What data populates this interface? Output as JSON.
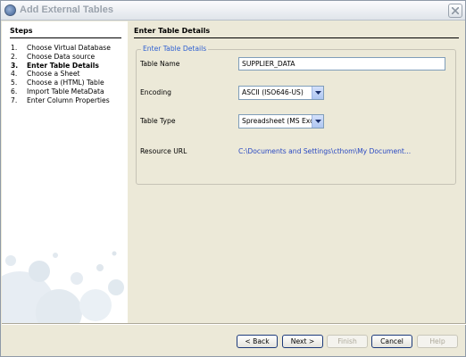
{
  "window": {
    "title": "Add External Tables"
  },
  "steps": {
    "header": "Steps",
    "items": [
      {
        "num": "1.",
        "label": "Choose Virtual Database"
      },
      {
        "num": "2.",
        "label": "Choose Data source"
      },
      {
        "num": "3.",
        "label": "Enter Table Details"
      },
      {
        "num": "4.",
        "label": "Choose a Sheet"
      },
      {
        "num": "5.",
        "label": "Choose a (HTML) Table"
      },
      {
        "num": "6.",
        "label": "Import Table MetaData"
      },
      {
        "num": "7.",
        "label": "Enter Column Properties"
      }
    ],
    "current": "Enter Table Details"
  },
  "content": {
    "header": "Enter Table Details",
    "group_title": "Enter Table Details",
    "table_name_label": "Table Name",
    "table_name_value": "SUPPLIER_DATA",
    "encoding_label": "Encoding",
    "encoding_value": "ASCII (ISO646-US)",
    "table_type_label": "Table Type",
    "table_type_value": "Spreadsheet (MS Excel)",
    "resource_url_label": "Resource URL",
    "resource_url_value": "C:\\Documents and Settings\\cthom\\My Document..."
  },
  "buttons": {
    "back": "< Back",
    "next": "Next >",
    "finish": "Finish",
    "cancel": "Cancel",
    "help": "Help"
  },
  "colors": {
    "group_title": "#2d5fd2",
    "link": "#2a49c2",
    "panel_bg": "#ece9d8"
  }
}
